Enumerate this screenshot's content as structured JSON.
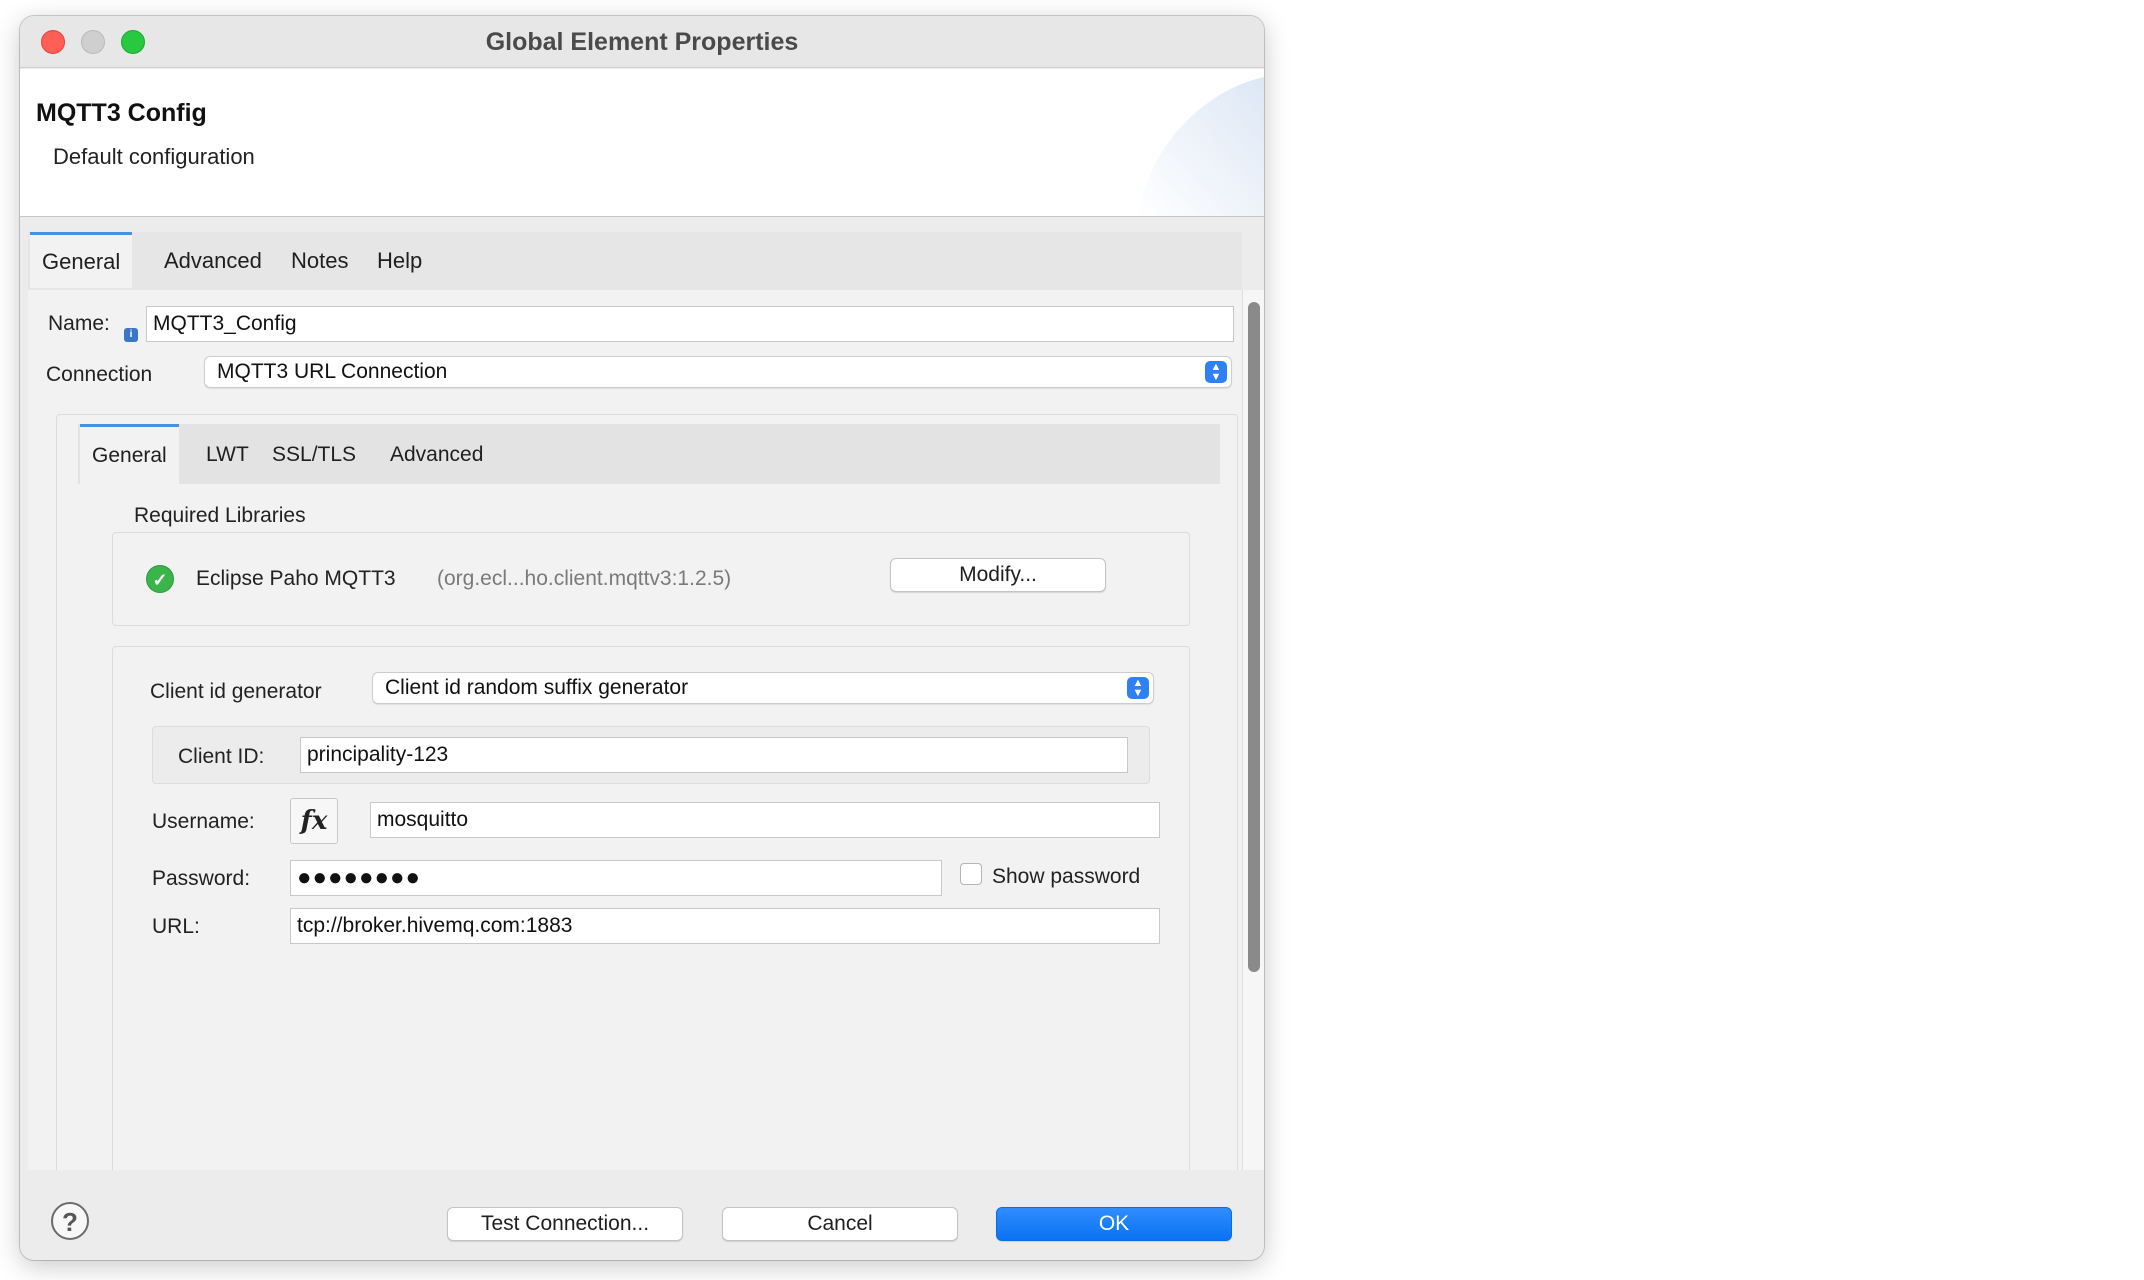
{
  "window": {
    "title": "Global Element Properties",
    "traffic_lights": {
      "close": "#ff5f57",
      "minimize": "#c8c8c8",
      "zoom": "#28c840"
    }
  },
  "header": {
    "title": "MQTT3 Config",
    "subtitle": "Default configuration"
  },
  "tabs": [
    "General",
    "Advanced",
    "Notes",
    "Help"
  ],
  "active_tab": "General",
  "general": {
    "name_label": "Name:",
    "name_value": "MQTT3_Config",
    "connection_label": "Connection",
    "connection_value": "MQTT3 URL Connection"
  },
  "connection_tabs": [
    "General",
    "LWT",
    "SSL/TLS",
    "Advanced"
  ],
  "active_connection_tab": "General",
  "required_libraries": {
    "heading": "Required Libraries",
    "library_name": "Eclipse Paho MQTT3",
    "library_coords": "(org.ecl...ho.client.mqttv3:1.2.5)",
    "status_icon": "check-circle-icon",
    "modify_label": "Modify..."
  },
  "connection_form": {
    "client_id_generator_label": "Client id generator",
    "client_id_generator_value": "Client id random suffix generator",
    "client_id_label": "Client ID:",
    "client_id_value": "principality-123",
    "username_label": "Username:",
    "username_fx_label": "fx",
    "username_value": "mosquitto",
    "password_label": "Password:",
    "password_value": "●●●●●●●●",
    "show_password_label": "Show password",
    "url_label": "URL:",
    "url_value": "tcp://broker.hivemq.com:1883"
  },
  "footer": {
    "help_icon": "question-circle-icon",
    "help_symbol": "?",
    "test_connection_label": "Test Connection...",
    "cancel_label": "Cancel",
    "ok_label": "OK"
  },
  "colors": {
    "accent": "#1a82ff",
    "tab_indicator": "#4a90d9",
    "check_green": "#3ab54a"
  }
}
